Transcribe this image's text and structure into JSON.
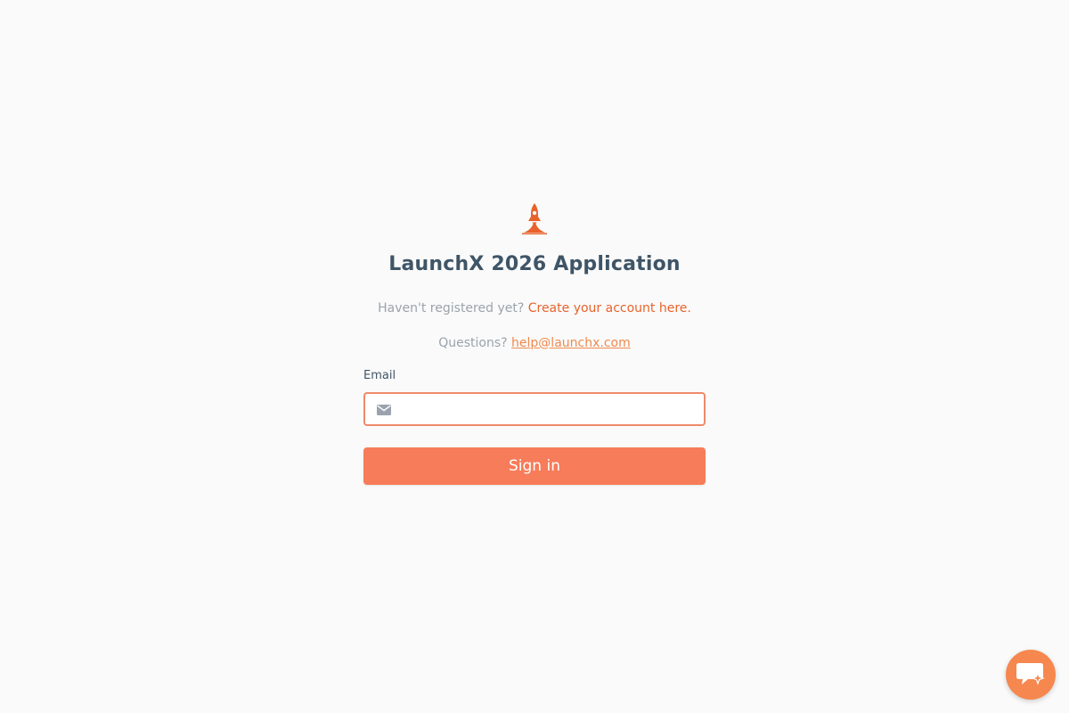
{
  "app": {
    "title": "LaunchX 2026 Application"
  },
  "intro": {
    "register_prompt": "Haven't registered yet?",
    "register_link": "Create your account here.",
    "questions_prompt": "Questions?",
    "contact_email": "help@launchx.com"
  },
  "form": {
    "email_label": "Email",
    "email_value": "",
    "email_placeholder": "",
    "submit_label": "Sign in"
  },
  "icons": {
    "logo": "rocket-icon",
    "email_field": "mail-icon",
    "chat_widget": "chat-icon"
  },
  "colors": {
    "accent": "#e8632b",
    "button": "#f67c5a",
    "input_border": "#ef8a6a",
    "title": "#3f5567",
    "muted_text": "#9aa3ad",
    "background": "#fafafa",
    "chat_widget": "#f5874f"
  }
}
